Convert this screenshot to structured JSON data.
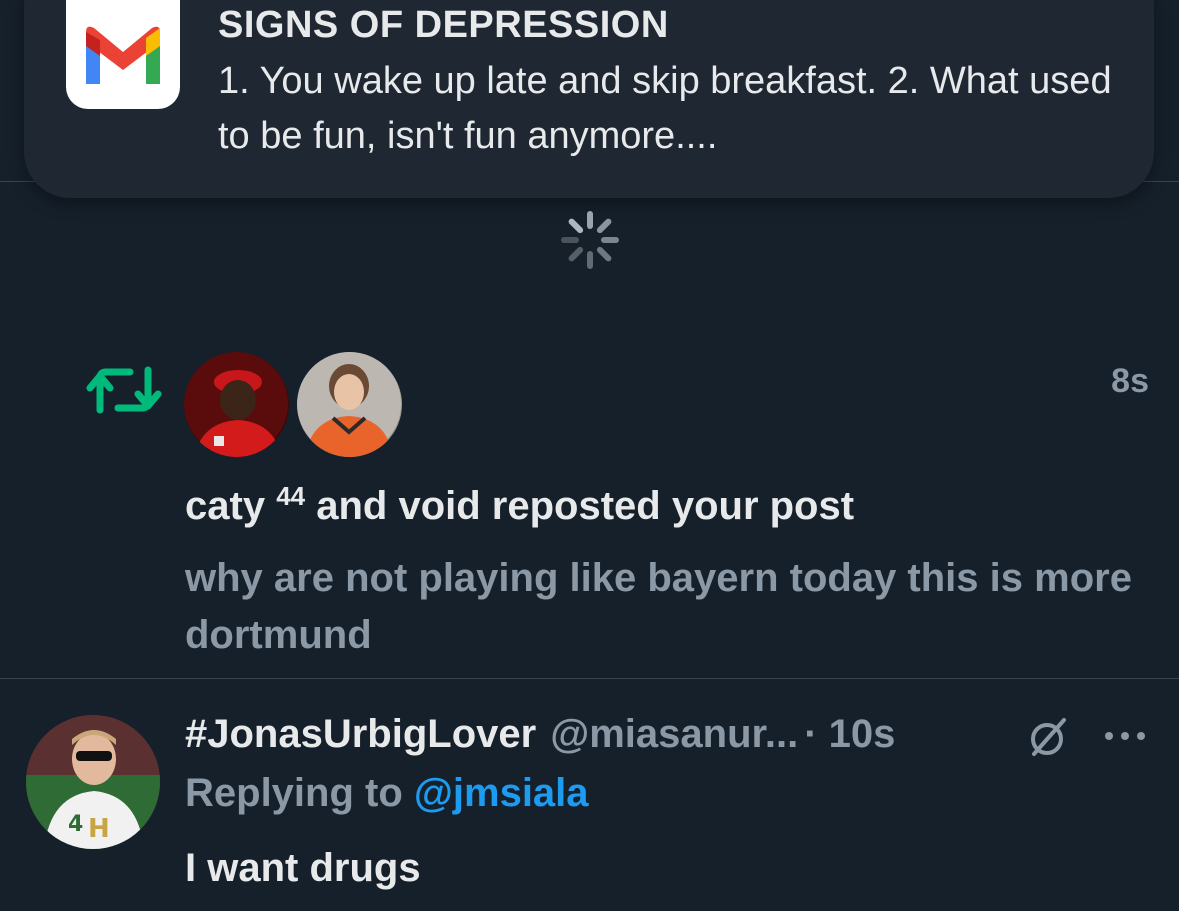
{
  "notification_banner": {
    "app_icon": "gmail-icon",
    "title": "SIGNS OF DEPRESSION",
    "body": "1. You wake up late and skip breakfast. 2. What used to be fun, isn't fun anymore...."
  },
  "loading": {
    "icon": "loading-spinner-icon"
  },
  "repost_notification": {
    "icon": "repost-icon",
    "avatars": [
      "caty-avatar",
      "void-avatar"
    ],
    "time": "8s",
    "actor_1": "caty",
    "actor_1_superscript": "44",
    "text_rest": " and void reposted your post",
    "preview": "why are not playing like bayern today this is more dortmund"
  },
  "reply_tweet": {
    "display_name": "#JonasUrbigLover",
    "handle": "@miasanur...",
    "separator_time": "· 10s",
    "replying_prefix": "Replying to ",
    "replying_to": "@jmsiala",
    "text": "I want drugs"
  },
  "colors": {
    "background": "#15202b",
    "banner": "#1e2732",
    "primary_text": "#e7e9ea",
    "secondary_text": "#8b98a5",
    "link": "#1d9bf0",
    "repost_green": "#00ba7c"
  }
}
